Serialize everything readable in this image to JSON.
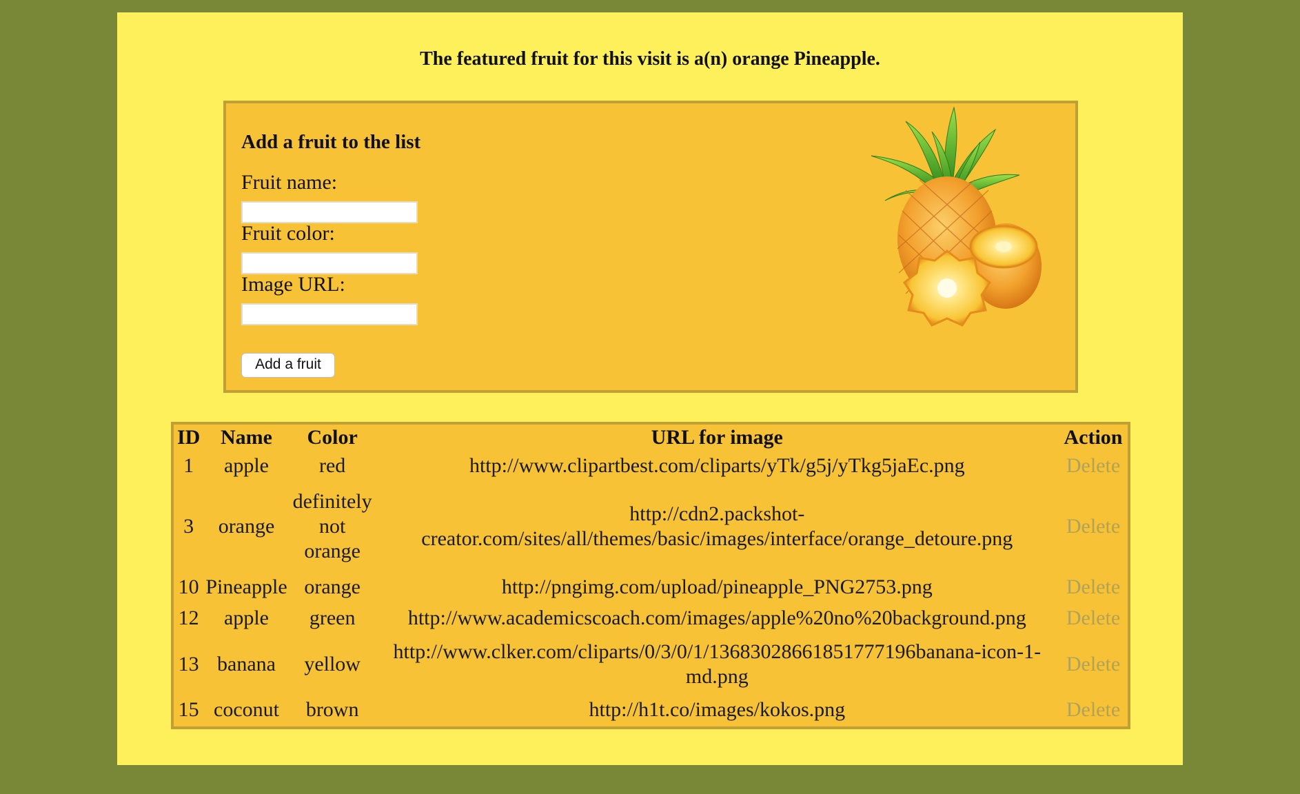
{
  "featured_text": "The featured fruit for this visit is a(n) orange Pineapple.",
  "form": {
    "heading": "Add a fruit to the list",
    "name_label": "Fruit name:",
    "name_value": "",
    "color_label": "Fruit color:",
    "color_value": "",
    "url_label": "Image URL:",
    "url_value": "",
    "submit_label": "Add a fruit"
  },
  "featured_image": "pineapple-illustration",
  "table": {
    "headers": [
      "ID",
      "Name",
      "Color",
      "URL for image",
      "Action"
    ],
    "rows": [
      {
        "id": "1",
        "name": "apple",
        "color": "red",
        "url": "http://www.clipartbest.com/cliparts/yTk/g5j/yTkg5jaEc.png",
        "action": "Delete"
      },
      {
        "id": "3",
        "name": "orange",
        "color": "definitely not orange",
        "url": "http://cdn2.packshot-creator.com/sites/all/themes/basic/images/interface/orange_detoure.png",
        "action": "Delete"
      },
      {
        "id": "10",
        "name": "Pineapple",
        "color": "orange",
        "url": "http://pngimg.com/upload/pineapple_PNG2753.png",
        "action": "Delete"
      },
      {
        "id": "12",
        "name": "apple",
        "color": "green",
        "url": "http://www.academicscoach.com/images/apple%20no%20background.png",
        "action": "Delete"
      },
      {
        "id": "13",
        "name": "banana",
        "color": "yellow",
        "url": "http://www.clker.com/cliparts/0/3/0/1/13683028661851777196banana-icon-1-md.png",
        "action": "Delete"
      },
      {
        "id": "15",
        "name": "coconut",
        "color": "brown",
        "url": "http://h1t.co/images/kokos.png",
        "action": "Delete"
      }
    ]
  },
  "colors": {
    "outer_background": "#788836",
    "page_background": "#fef05b",
    "panel_background": "#f7c236",
    "panel_border": "#c0a034",
    "delete_link": "#b2a257"
  }
}
